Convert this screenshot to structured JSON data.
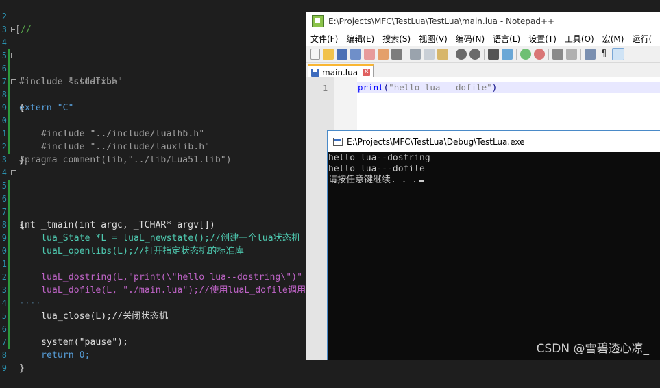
{
  "editor": {
    "lines": [
      {
        "num": "2",
        "text": "//"
      },
      {
        "num": "3",
        "text": ""
      },
      {
        "num": "4",
        "text": "#include \"stdafx.h\""
      },
      {
        "num": "5",
        "text": "#include <cstdlib>"
      },
      {
        "num": "6",
        "text": "extern \"C\""
      },
      {
        "num": "7",
        "text": "{"
      },
      {
        "num": "8",
        "text": "#include \"../include/lua.h\""
      },
      {
        "num": "9",
        "text": "#include \"../include/lualib.h\""
      },
      {
        "num": "0",
        "text": "#include \"../include/lauxlib.h\""
      },
      {
        "num": "1",
        "text": "}"
      },
      {
        "num": "2",
        "text": "#pragma comment(lib,\"../lib/Lua51.lib\")"
      },
      {
        "num": "3",
        "text": ""
      },
      {
        "num": "4",
        "text": ""
      },
      {
        "num": "5",
        "text": "int _tmain(int argc, _TCHAR* argv[])"
      },
      {
        "num": "6",
        "text": "{"
      },
      {
        "num": "7",
        "text": "lua_State *L = luaL_newstate();//创建一个lua状态机"
      },
      {
        "num": "8",
        "text": "luaL_openlibs(L);//打开指定状态机的标准库"
      },
      {
        "num": "9",
        "text": ""
      },
      {
        "num": "0",
        "text": "luaL_dostring(L,\"print(\\\"hello lua--dostring\\\")\""
      },
      {
        "num": "1",
        "text": "luaL_dofile(L, \"./main.lua\");//使用luaL_dofile调用"
      },
      {
        "num": "2",
        "text": ""
      },
      {
        "num": "3",
        "text": "lua_close(L);//关闭状态机"
      },
      {
        "num": "4",
        "text": ""
      },
      {
        "num": "5",
        "text": "system(\"pause\");"
      },
      {
        "num": "6",
        "text": ""
      },
      {
        "num": "7",
        "text": "return 0;"
      },
      {
        "num": "8",
        "text": "}"
      },
      {
        "num": "9",
        "text": ""
      }
    ]
  },
  "notepad": {
    "title": "E:\\Projects\\MFC\\TestLua\\TestLua\\main.lua - Notepad++",
    "menu": [
      "文件(F)",
      "编辑(E)",
      "搜索(S)",
      "视图(V)",
      "编码(N)",
      "语言(L)",
      "设置(T)",
      "工具(O)",
      "宏(M)",
      "运行("
    ],
    "tab_label": "main.lua",
    "line_number": "1",
    "code_keyword": "print",
    "code_open": "(",
    "code_string": "\"hello lua---dofile\"",
    "code_close": ")"
  },
  "console": {
    "title": "E:\\Projects\\MFC\\TestLua\\Debug\\TestLua.exe",
    "output": [
      "hello lua--dostring",
      "hello lua---dofile",
      "请按任意键继续. . ."
    ]
  },
  "watermark": "CSDN @雪碧透心凉_",
  "colors": {
    "keyword": "#569cd6",
    "string": "#d69d85",
    "comment": "#57a64a",
    "type": "#4ec9b0",
    "change_bar": "#2c9a3c"
  }
}
